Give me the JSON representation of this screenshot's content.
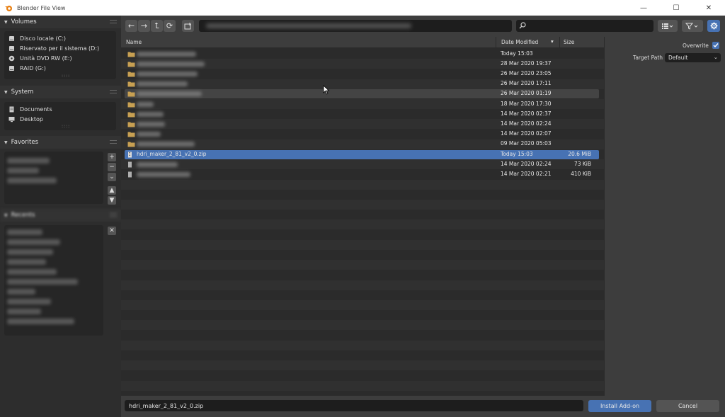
{
  "window": {
    "title": "Blender File View",
    "minimize": "—",
    "maximize": "☐",
    "close": "✕"
  },
  "sidebar": {
    "volumes_header": "Volumes",
    "volumes": [
      {
        "label": "Disco locale (C:)",
        "icon": "hard-drive-icon"
      },
      {
        "label": "Riservato per il sistema (D:)",
        "icon": "hard-drive-icon"
      },
      {
        "label": "Unità DVD RW (E:)",
        "icon": "disc-icon"
      },
      {
        "label": "RAID (G:)",
        "icon": "hard-drive-icon"
      }
    ],
    "system_header": "System",
    "system": [
      {
        "label": "Documents",
        "icon": "documents-icon"
      },
      {
        "label": "Desktop",
        "icon": "desktop-icon"
      }
    ],
    "favorites_header": "Favorites",
    "recents_header": "Recents",
    "more_dots": "::::"
  },
  "navbar": {
    "back": "←",
    "forward": "→",
    "parent": "⮤",
    "refresh": "⟳",
    "new_folder": "+",
    "search_placeholder": ""
  },
  "columns": {
    "name": "Name",
    "date": "Date Modified",
    "size": "Size"
  },
  "files": [
    {
      "type": "folder",
      "name": "",
      "date": "Today 15:03",
      "size": ""
    },
    {
      "type": "folder",
      "name": "",
      "date": "28 Mar 2020 19:37",
      "size": ""
    },
    {
      "type": "folder",
      "name": "",
      "date": "26 Mar 2020 23:05",
      "size": ""
    },
    {
      "type": "folder",
      "name": "",
      "date": "26 Mar 2020 17:11",
      "size": ""
    },
    {
      "type": "folder",
      "name": "",
      "date": "26 Mar 2020 01:19",
      "size": "",
      "hover": true
    },
    {
      "type": "folder",
      "name": "",
      "date": "18 Mar 2020 17:30",
      "size": ""
    },
    {
      "type": "folder",
      "name": "",
      "date": "14 Mar 2020 02:37",
      "size": ""
    },
    {
      "type": "folder",
      "name": "",
      "date": "14 Mar 2020 02:24",
      "size": ""
    },
    {
      "type": "folder",
      "name": "",
      "date": "14 Mar 2020 02:07",
      "size": ""
    },
    {
      "type": "folder",
      "name": "",
      "date": "09 Mar 2020 05:03",
      "size": ""
    },
    {
      "type": "zip",
      "name": "hdri_maker_2_81_v2_0.zip",
      "date": "Today 15:03",
      "size": "20.6 MiB",
      "selected": true
    },
    {
      "type": "file",
      "name": "",
      "date": "14 Mar 2020 02:24",
      "size": "73 KiB"
    },
    {
      "type": "file",
      "name": "",
      "date": "14 Mar 2020 02:21",
      "size": "410 KiB"
    }
  ],
  "options": {
    "overwrite_label": "Overwrite",
    "overwrite_checked": true,
    "target_path_label": "Target Path",
    "target_path_value": "Default"
  },
  "bottom": {
    "filename": "hdri_maker_2_81_v2_0.zip",
    "install_label": "Install Add-on",
    "cancel_label": "Cancel"
  },
  "colors": {
    "accent": "#4772b3",
    "folder": "#c8a052"
  }
}
